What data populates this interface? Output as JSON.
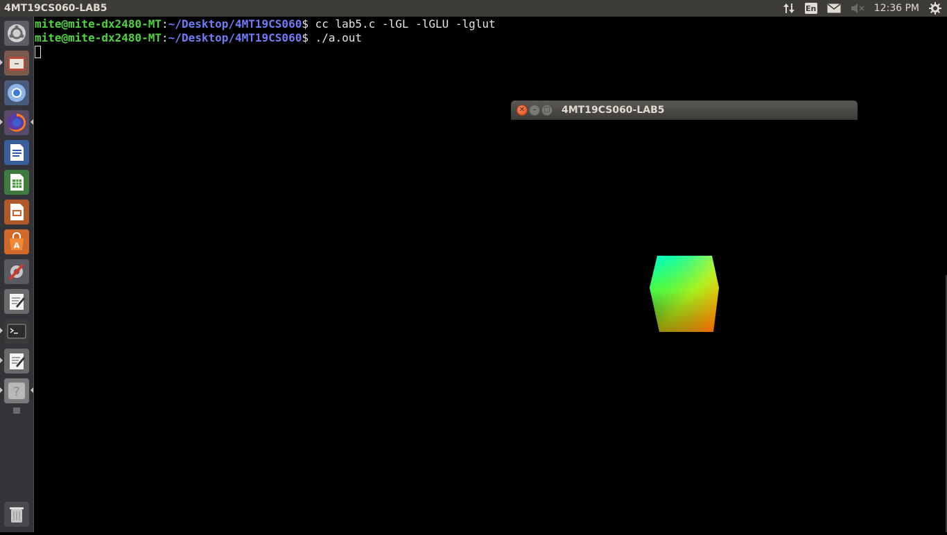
{
  "top_panel": {
    "window_title": "4MT19CS060-LAB5",
    "lang_indicator": "En",
    "clock": "12:36 PM",
    "icons": [
      "network-icon",
      "keyboard-language-icon",
      "mail-icon",
      "volume-muted-icon",
      "system-gear-icon"
    ]
  },
  "launcher": {
    "items": [
      {
        "name": "dash-home",
        "icon": "ubuntu-logo-icon"
      },
      {
        "name": "files",
        "icon": "file-manager-icon"
      },
      {
        "name": "chromium",
        "icon": "chromium-icon"
      },
      {
        "name": "firefox",
        "icon": "firefox-icon"
      },
      {
        "name": "libreoffice-writer",
        "icon": "writer-icon"
      },
      {
        "name": "libreoffice-calc",
        "icon": "calc-icon"
      },
      {
        "name": "libreoffice-impress",
        "icon": "impress-icon"
      },
      {
        "name": "software-center",
        "icon": "software-center-icon"
      },
      {
        "name": "system-settings",
        "icon": "settings-tools-icon"
      },
      {
        "name": "text-editor",
        "icon": "text-editor-icon"
      },
      {
        "name": "terminal",
        "icon": "terminal-icon"
      },
      {
        "name": "text-editor-2",
        "icon": "text-editor-icon"
      },
      {
        "name": "help",
        "icon": "help-icon"
      },
      {
        "name": "trash",
        "icon": "trash-icon"
      }
    ]
  },
  "terminal": {
    "lines": [
      {
        "user": "mite@mite-dx2480-MT",
        "sep": ":",
        "path": "~/Desktop/4MT19CS060",
        "prompt": "$ ",
        "command": "cc lab5.c -lGL -lGLU -lglut"
      },
      {
        "user": "mite@mite-dx2480-MT",
        "sep": ":",
        "path": "~/Desktop/4MT19CS060",
        "prompt": "$ ",
        "command": "./a.out"
      }
    ]
  },
  "gl_window": {
    "title": "4MT19CS060-LAB5",
    "close_glyph": "✕",
    "minimize_glyph": "–",
    "maximize_glyph": "□",
    "scene": "rgb-color-cube"
  },
  "colors": {
    "panel_bg": "#3c3b37",
    "launcher_bg": "#34333a",
    "prompt_user": "#4fd43e",
    "prompt_path": "#6f7cf6",
    "close_button": "#e0491c"
  }
}
